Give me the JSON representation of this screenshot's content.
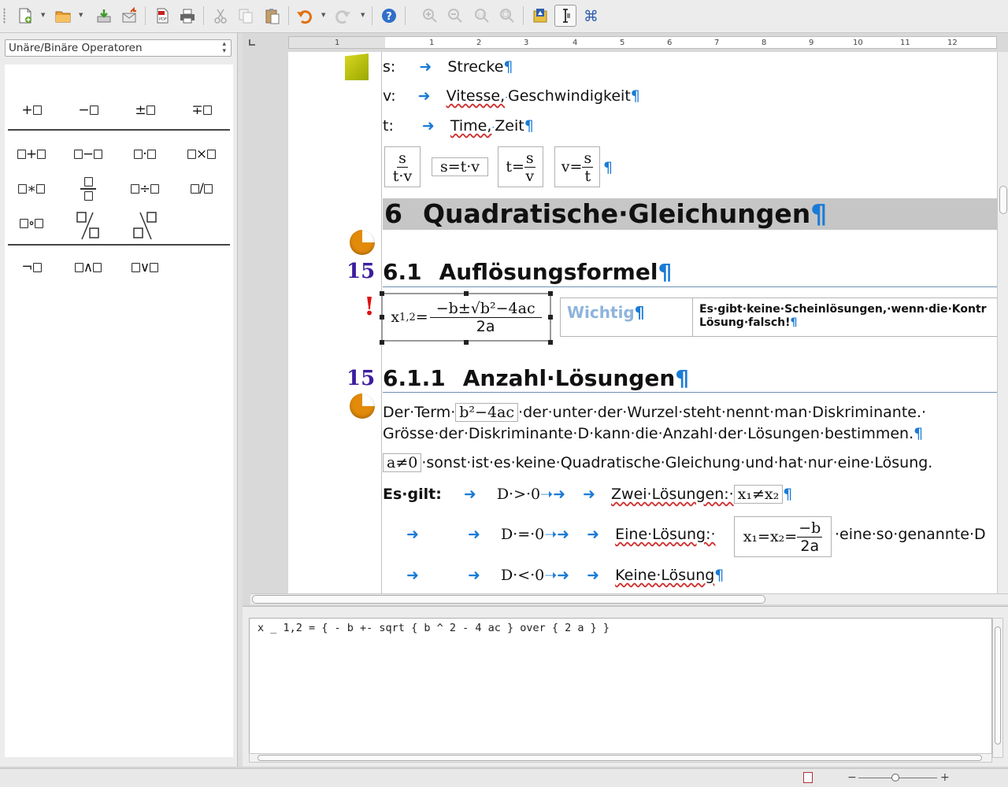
{
  "toolbar": {
    "icons": [
      "new-icon",
      "open-icon",
      "save-icon",
      "export-icon",
      "pdf-icon",
      "print-icon",
      "cut-icon",
      "copy-icon",
      "paste-icon",
      "undo-icon",
      "redo-icon",
      "help-icon",
      "zoom-in-icon",
      "zoom-out-icon",
      "zoom-100-icon",
      "show-all-icon",
      "update-icon",
      "formula-cursor-icon",
      "symbols-icon"
    ]
  },
  "left_panel": {
    "category_select": "Unäre/Binäre Operatoren",
    "unary_ops": [
      "+",
      "−",
      "±",
      "∓"
    ],
    "binary_ops_row1": [
      "+",
      "−",
      "·",
      "×"
    ],
    "binary_ops_row2": [
      "∗",
      "÷",
      "/"
    ],
    "binary_ops_row3": [
      "∘"
    ],
    "logic_ops": [
      "¬",
      "∧",
      "∨"
    ]
  },
  "ruler": {
    "labels": [
      "1",
      "1",
      "2",
      "3",
      "4",
      "5",
      "6",
      "7",
      "8",
      "9",
      "10",
      "11",
      "12"
    ]
  },
  "document": {
    "lines": [
      {
        "label": "s:",
        "term": "Strecke"
      },
      {
        "label": "v:",
        "term_a": "Vitesse,",
        "term_b": "Geschwindigkeit"
      },
      {
        "label": "t:",
        "term_a": "Time,",
        "term_b": "Zeit"
      }
    ],
    "formula_row": {
      "f1_num": "s",
      "f1_den": "t·v",
      "f2": "s=t·v",
      "f3_lhs": "t=",
      "f3_num": "s",
      "f3_den": "v",
      "f4_lhs": "v=",
      "f4_num": "s",
      "f4_den": "t"
    },
    "heading1": {
      "number": "6",
      "text": "Quadratische·Gleichungen"
    },
    "heading2": {
      "number": "6.1",
      "text": "Auflösungsformel",
      "margin_num": "15"
    },
    "selected_formula": {
      "lhs": "x",
      "sub": "1,2",
      "eq": "=",
      "num": "−b±√b²−4ac",
      "den": "2a"
    },
    "important": {
      "title": "Wichtig",
      "line1": "Es·gibt·keine·Scheinlösungen,·wenn·die·Kontr",
      "line2": "Lösung·falsch!"
    },
    "heading3": {
      "number": "6.1.1",
      "text": "Anzahl·Lösungen",
      "margin_num": "15"
    },
    "paragraph": {
      "pre": "Der·Term·",
      "term_formula": "b²−4ac",
      "post": "·der·unter·der·Wurzel·steht·nennt·man·Diskriminante.·",
      "line2": "Grösse·der·Diskriminante·D·kann·die·Anzahl·der·Lösungen·bestimmen."
    },
    "condition": {
      "formula": "a≠0",
      "text": "·sonst·ist·es·keine·Quadratische·Gleichung·und·hat·nur·eine·Lösung."
    },
    "cases": [
      {
        "lead": "Es·gilt:",
        "cond": "D·>·0",
        "desc": "Zwei·Lösungen:·",
        "formula": "x₁≠x₂",
        "tail": ""
      },
      {
        "lead": "",
        "cond": "D·=·0",
        "desc": "Eine·Lösung:·",
        "formula_lhs": "x₁=x₂=",
        "formula_num": "−b",
        "formula_den": "2a",
        "tail": "·eine·so·genannte·D"
      },
      {
        "lead": "",
        "cond": "D·<·0",
        "desc": "Keine·Lösung",
        "tail": ""
      }
    ]
  },
  "command": {
    "text": "x _ 1,2 = { - b +- sqrt { b ^ 2 - 4 ac } over { 2 a } }"
  },
  "colors": {
    "paragraph_mark": "#1a7bd6",
    "margin_number": "#3d1e9e",
    "important_title": "#8eb4dc"
  }
}
